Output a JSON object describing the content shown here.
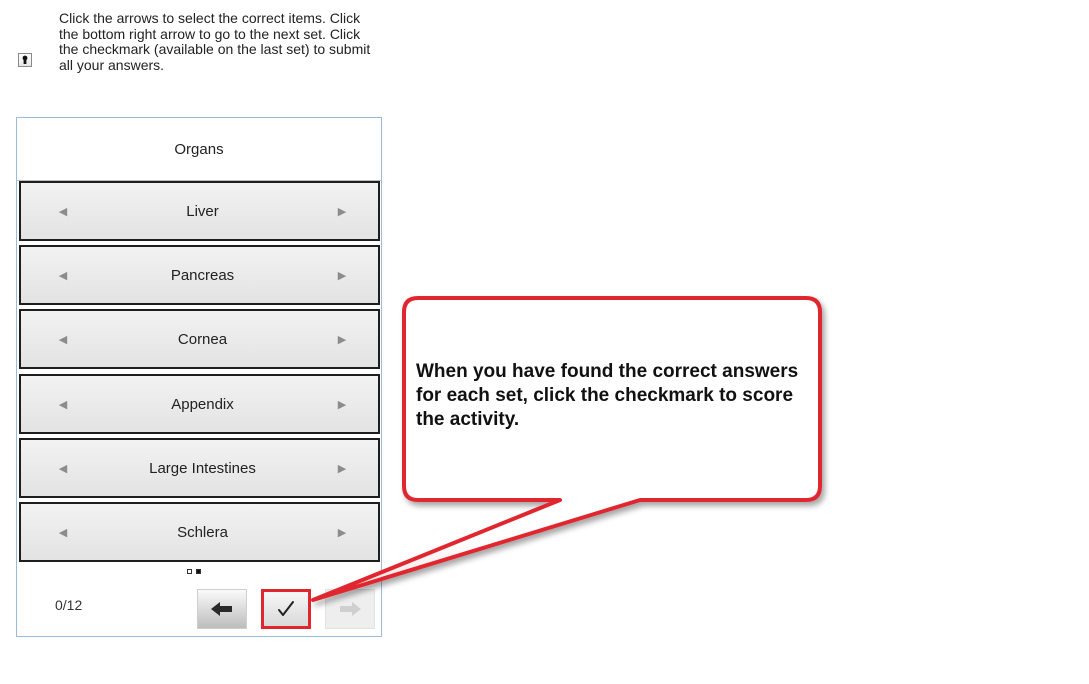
{
  "instructions": {
    "text": "Click the arrows to select the correct items. Click the bottom right arrow to go to the next set. Click the checkmark (available on the last set) to submit all your answers.",
    "icon": "keyhole-icon"
  },
  "activity": {
    "header": "Organs",
    "items": [
      {
        "label": "Liver"
      },
      {
        "label": "Pancreas"
      },
      {
        "label": "Cornea"
      },
      {
        "label": "Appendix"
      },
      {
        "label": "Large Intestines"
      },
      {
        "label": "Schlera"
      }
    ],
    "pager": {
      "pages": 2,
      "current": 2
    },
    "score": "0/12",
    "controls": {
      "back_icon": "back-arrow-icon",
      "check_icon": "checkmark-icon",
      "next_icon": "next-arrow-icon"
    }
  },
  "callout": {
    "text": "When you have found the correct answers for each set, click the checkmark to score the activity.",
    "border_color": "#e0262e"
  }
}
